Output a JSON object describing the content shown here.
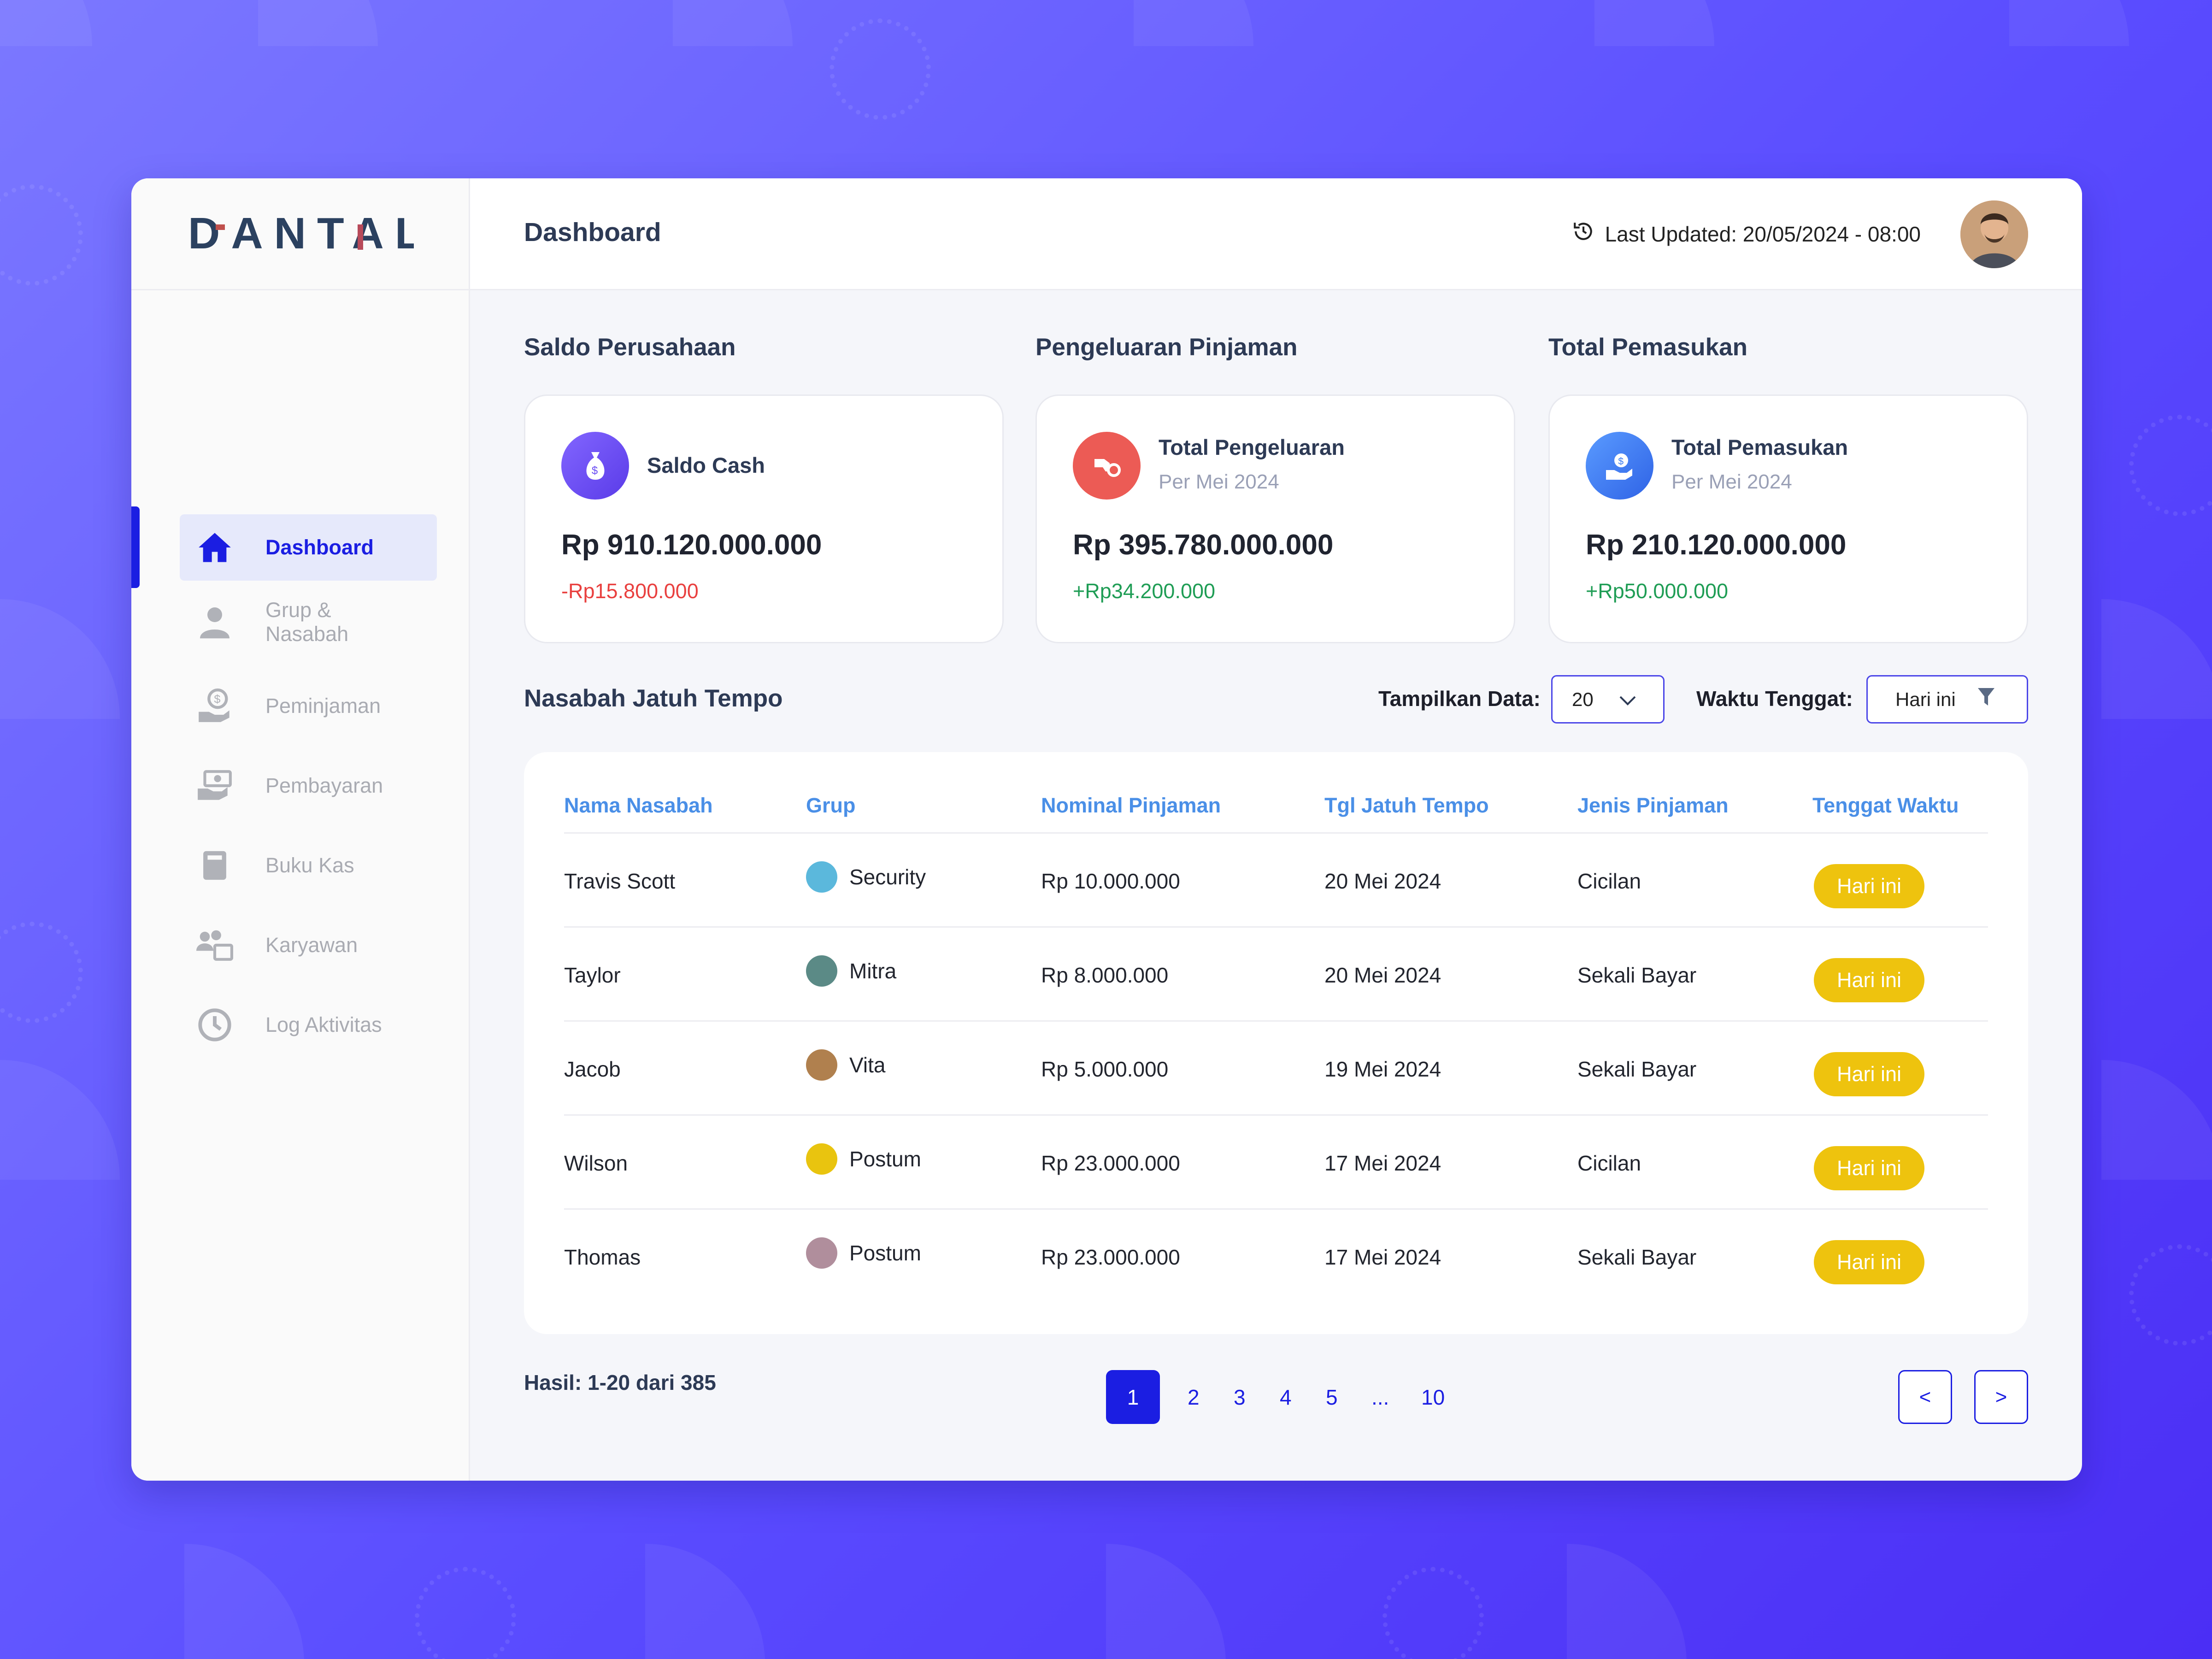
{
  "brand": {
    "name": "DANTAL"
  },
  "header": {
    "title": "Dashboard",
    "last_updated": "Last Updated: 20/05/2024 - 08:00"
  },
  "sidebar": {
    "items": [
      {
        "label": "Dashboard",
        "icon": "home-icon",
        "active": true
      },
      {
        "label": "Grup & Nasabah",
        "icon": "user-icon"
      },
      {
        "label": "Peminjaman",
        "icon": "loan-hand-icon"
      },
      {
        "label": "Pembayaran",
        "icon": "payment-icon"
      },
      {
        "label": "Buku Kas",
        "icon": "book-icon"
      },
      {
        "label": "Karyawan",
        "icon": "team-icon"
      },
      {
        "label": "Log Aktivitas",
        "icon": "clock-icon"
      }
    ]
  },
  "stats": [
    {
      "section": "Saldo Perusahaan",
      "title": "Saldo Cash",
      "subtitle": "",
      "amount": "Rp 910.120.000.000",
      "change": "-Rp15.800.000",
      "trend": "negative",
      "icon": "money-bag-icon",
      "color": "#6a4df4"
    },
    {
      "section": "Pengeluaran Pinjaman",
      "title": "Total Pengeluaran",
      "subtitle": "Per Mei 2024",
      "amount": "Rp 395.780.000.000",
      "change": "+Rp34.200.000",
      "trend": "positive",
      "icon": "money-out-icon",
      "color": "#ec5b55"
    },
    {
      "section": "Total Pemasukan",
      "title": "Total Pemasukan",
      "subtitle": "Per Mei 2024",
      "amount": "Rp 210.120.000.000",
      "change": "+Rp50.000.000",
      "trend": "positive",
      "icon": "money-in-icon",
      "color": "#3f7ef0"
    }
  ],
  "due": {
    "title": "Nasabah Jatuh Tempo",
    "show_label": "Tampilkan Data:",
    "show_value": "20",
    "deadline_label": "Waktu Tenggat:",
    "deadline_value": "Hari ini",
    "columns": [
      "Nama Nasabah",
      "Grup",
      "Nominal Pinjaman",
      "Tgl Jatuh Tempo",
      "Jenis Pinjaman",
      "Tenggat Waktu"
    ],
    "rows": [
      {
        "name": "Travis Scott",
        "group": "Security",
        "group_color": "#5bb8dc",
        "amount": "Rp 10.000.000",
        "date": "20 Mei 2024",
        "type": "Cicilan",
        "type_status": "negative",
        "deadline": "Hari ini"
      },
      {
        "name": "Taylor",
        "group": "Mitra",
        "group_color": "#5b8a86",
        "amount": "Rp 8.000.000",
        "date": "20 Mei 2024",
        "type": "Sekali Bayar",
        "type_status": "positive",
        "deadline": "Hari ini"
      },
      {
        "name": "Jacob",
        "group": "Vita",
        "group_color": "#b0804e",
        "amount": "Rp 5.000.000",
        "date": "19 Mei 2024",
        "type": "Sekali Bayar",
        "type_status": "positive",
        "deadline": "Hari ini"
      },
      {
        "name": "Wilson",
        "group": "Postum",
        "group_color": "#e9c40f",
        "amount": "Rp 23.000.000",
        "date": "17 Mei 2024",
        "type": "Cicilan",
        "type_status": "negative",
        "deadline": "Hari ini"
      },
      {
        "name": "Thomas",
        "group": "Postum",
        "group_color": "#b08e9c",
        "amount": "Rp 23.000.000",
        "date": "17 Mei 2024",
        "type": "Sekali Bayar",
        "type_status": "positive",
        "deadline": "Hari ini"
      }
    ]
  },
  "pagination": {
    "results": "Hasil: 1-20 dari 385",
    "pages": [
      "1",
      "2",
      "3",
      "4",
      "5",
      "...",
      "10"
    ],
    "current": "1",
    "prev": "<",
    "next": ">"
  }
}
